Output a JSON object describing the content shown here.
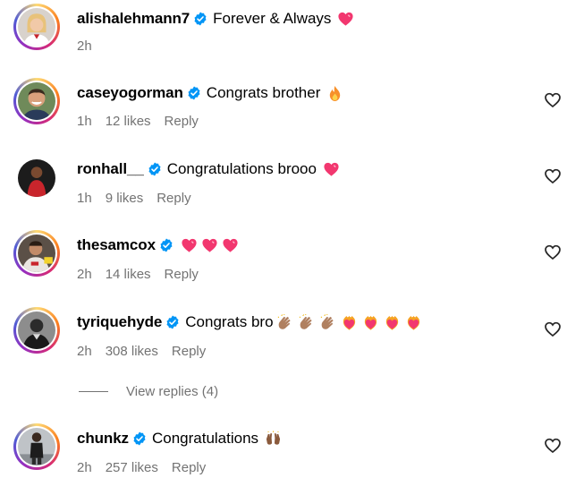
{
  "colors": {
    "verified": "#0095f6",
    "meta_text": "#737373",
    "heart_pink": "#f2376f",
    "story_ring": "gradient"
  },
  "comments": [
    {
      "username": "alishalehmann7",
      "verified": true,
      "text": "Forever & Always",
      "emojis": [
        "heart-pink"
      ],
      "time": "2h",
      "likes": "",
      "reply": "",
      "has_like_button": false,
      "avatar": "avatar-woman-white-top"
    },
    {
      "username": "caseyogorman",
      "verified": true,
      "text": "Congrats brother",
      "emojis": [
        "fire"
      ],
      "time": "1h",
      "likes": "12 likes",
      "reply": "Reply",
      "has_like_button": true,
      "avatar": "avatar-man-smiling"
    },
    {
      "username": "ronhall__",
      "verified": true,
      "text": "Congratulations brooo",
      "emojis": [
        "heart-pink"
      ],
      "time": "1h",
      "likes": "9 likes",
      "reply": "Reply",
      "has_like_button": true,
      "avatar": "avatar-man-red-shirt"
    },
    {
      "username": "thesamcox",
      "verified": true,
      "text": "",
      "emojis": [
        "heart-pink",
        "heart-pink",
        "heart-pink"
      ],
      "time": "2h",
      "likes": "14 likes",
      "reply": "Reply",
      "has_like_button": true,
      "avatar": "avatar-man-sports-kit"
    },
    {
      "username": "tyriquehyde",
      "verified": true,
      "text": "Congrats bro",
      "emojis": [
        "clap",
        "clap",
        "clap",
        "heart-fire",
        "heart-fire",
        "heart-fire",
        "heart-fire"
      ],
      "time": "2h",
      "likes": "308 likes",
      "reply": "Reply",
      "has_like_button": true,
      "avatar": "avatar-man-bw"
    },
    {
      "username": "chunkz",
      "verified": true,
      "text": "Congratulations",
      "emojis": [
        "raising-hands"
      ],
      "time": "2h",
      "likes": "257 likes",
      "reply": "Reply",
      "has_like_button": true,
      "avatar": "avatar-man-standing"
    }
  ],
  "view_replies": "View replies (4)"
}
